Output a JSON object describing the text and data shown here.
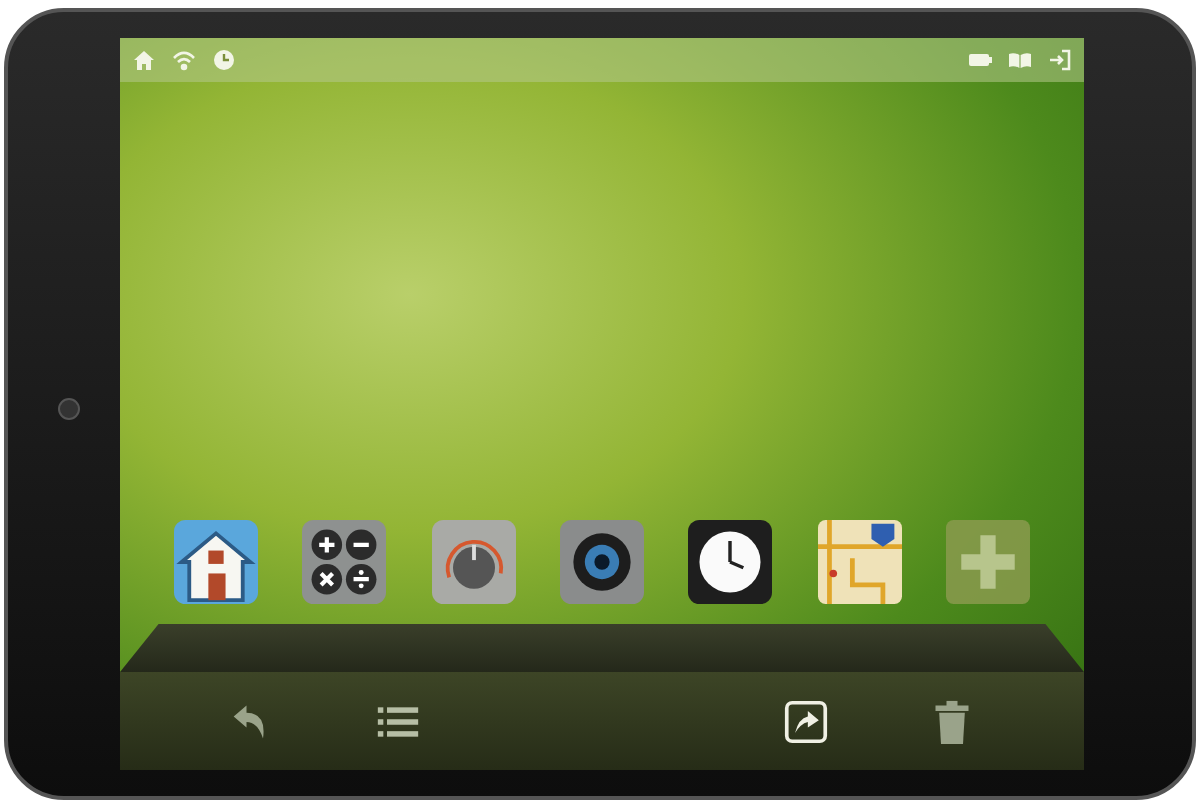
{
  "status_bar": {
    "left_icons": [
      {
        "kind": "home"
      },
      {
        "kind": "wifi"
      },
      {
        "kind": "clock"
      }
    ],
    "right_icons": [
      {
        "kind": "battery"
      },
      {
        "kind": "book"
      },
      {
        "kind": "exit"
      }
    ]
  },
  "dock": [
    {
      "kind": "house"
    },
    {
      "kind": "calculator"
    },
    {
      "kind": "dial"
    },
    {
      "kind": "camera"
    },
    {
      "kind": "clock"
    },
    {
      "kind": "map"
    },
    {
      "kind": "add"
    }
  ],
  "toolbar": [
    {
      "kind": "back"
    },
    {
      "kind": "list"
    },
    {
      "kind": "spacer"
    },
    {
      "kind": "share"
    },
    {
      "kind": "trash"
    }
  ]
}
